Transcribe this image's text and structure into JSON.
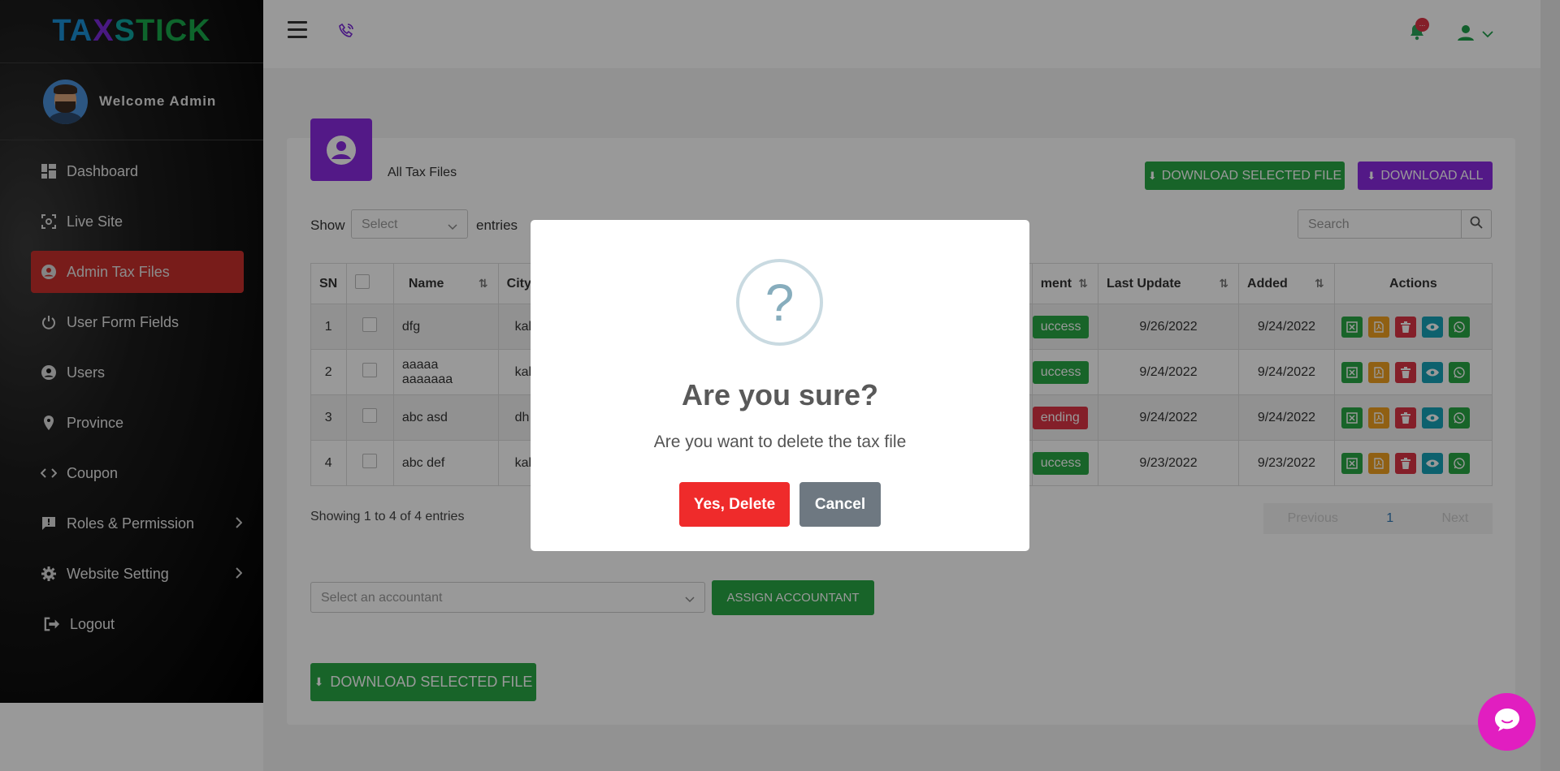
{
  "brand": {
    "logo": [
      "TA",
      "X",
      "S",
      "TICK"
    ]
  },
  "sidebar": {
    "welcome": "Welcome Admin",
    "items": [
      {
        "label": "Dashboard",
        "icon": "dashboard-icon"
      },
      {
        "label": "Live Site",
        "icon": "live-site-icon"
      },
      {
        "label": "Admin Tax Files",
        "icon": "user-circle-icon",
        "active": true
      },
      {
        "label": "User Form Fields",
        "icon": "power-icon"
      },
      {
        "label": "Users",
        "icon": "user-circle-icon"
      },
      {
        "label": "Province",
        "icon": "map-pin-icon"
      },
      {
        "label": "Coupon",
        "icon": "code-icon"
      },
      {
        "label": "Roles & Permission",
        "icon": "report-icon",
        "submenu": true
      },
      {
        "label": "Website Setting",
        "icon": "gear-icon",
        "submenu": true
      },
      {
        "label": "Logout",
        "icon": "logout-icon"
      }
    ]
  },
  "topbar": {
    "notification_count": "..."
  },
  "page": {
    "title": "All Tax Files",
    "download_selected": "DOWNLOAD SELECTED FILE",
    "download_all": "DOWNLOAD ALL",
    "show_label": "Show",
    "entries_label": "entries",
    "entries_select_placeholder": "Select",
    "search_placeholder": "Search",
    "table": {
      "headers": [
        "SN",
        "",
        "Name",
        "City",
        "ment",
        "Last Update",
        "Added",
        "Actions"
      ],
      "rows": [
        {
          "sn": "1",
          "name": "dfg",
          "city": "kal",
          "status": "uccess",
          "status_type": "success",
          "last_update": "9/26/2022",
          "added": "9/24/2022"
        },
        {
          "sn": "2",
          "name": "aaaaa aaaaaaa",
          "city": "kal",
          "status": "uccess",
          "status_type": "success",
          "last_update": "9/24/2022",
          "added": "9/24/2022"
        },
        {
          "sn": "3",
          "name": "abc asd",
          "city": "dh",
          "status": "ending",
          "status_type": "pending",
          "last_update": "9/24/2022",
          "added": "9/24/2022"
        },
        {
          "sn": "4",
          "name": "abc def",
          "city": "kal",
          "status": "uccess",
          "status_type": "success",
          "last_update": "9/23/2022",
          "added": "9/23/2022"
        }
      ]
    },
    "showing_text": "Showing 1 to 4 of 4 entries",
    "pager": {
      "previous": "Previous",
      "current": "1",
      "next": "Next"
    },
    "accountant_placeholder": "Select an accountant",
    "assign_button": "ASSIGN ACCOUNTANT",
    "download_selected_bottom": "DOWNLOAD SELECTED FILE"
  },
  "modal": {
    "icon": "?",
    "title": "Are you sure?",
    "text": "Are you want to delete the tax file",
    "confirm": "Yes, Delete",
    "cancel": "Cancel"
  },
  "colors": {
    "accent_red": "#c9302c",
    "green": "#28a745",
    "purple": "#8a2be2",
    "chat": "#e11ec0"
  }
}
